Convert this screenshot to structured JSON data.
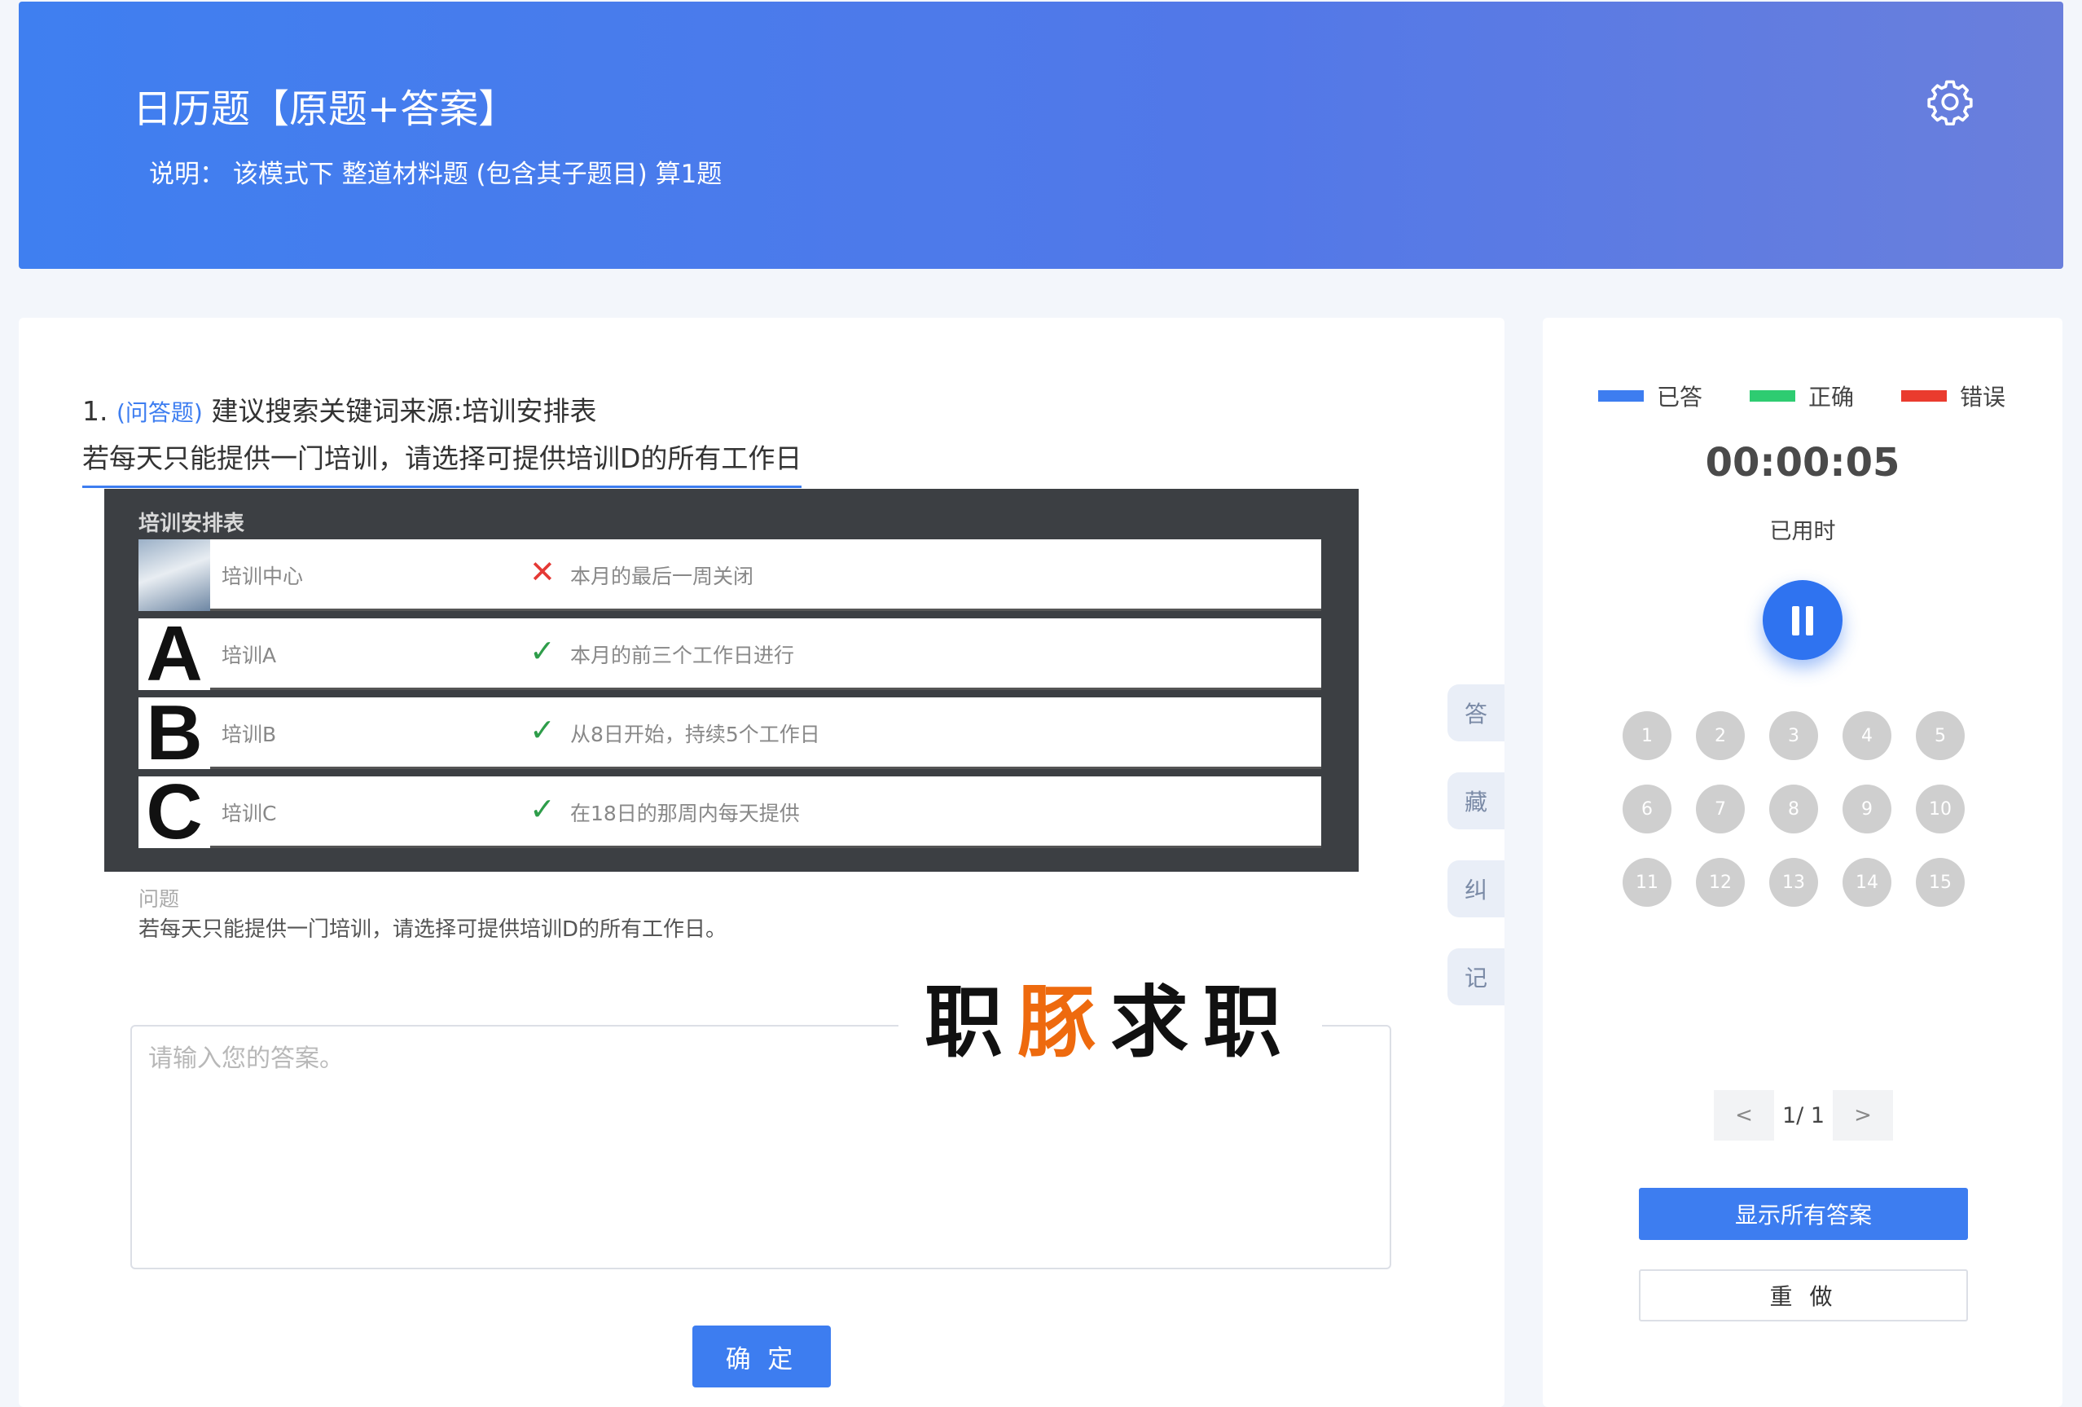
{
  "header": {
    "title": "日历题【原题+答案】",
    "description": "说明：  该模式下 整道材料题 (包含其子题目) 算1题",
    "settings_icon": "gear-icon"
  },
  "question": {
    "number": "1.",
    "type": "(问答题)",
    "source": "建议搜索关键词来源:培训安排表",
    "prompt": "若每天只能提供一门培训，请选择可提供培训D的所有工作日"
  },
  "side_tabs": [
    "答",
    "藏",
    "纠",
    "记"
  ],
  "reference_image": {
    "title": "培训安排表",
    "rows": [
      {
        "letter": "",
        "name": "培训中心",
        "mark": "✕",
        "mark_color": "#e53935",
        "desc": "本月的最后一周关闭"
      },
      {
        "letter": "A",
        "name": "培训A",
        "mark": "✓",
        "mark_color": "#2e9d4a",
        "desc": "本月的前三个工作日进行"
      },
      {
        "letter": "B",
        "name": "培训B",
        "mark": "✓",
        "mark_color": "#2e9d4a",
        "desc": "从8日开始，持续5个工作日"
      },
      {
        "letter": "C",
        "name": "培训C",
        "mark": "✓",
        "mark_color": "#2e9d4a",
        "desc": "在18日的那周内每天提供"
      }
    ],
    "question_label": "问题",
    "question_text": "若每天只能提供一门培训，请选择可提供培训D的所有工作日。"
  },
  "answer": {
    "placeholder": "请输入您的答案。",
    "value": ""
  },
  "watermark": {
    "part1": "职",
    "part2": "豚",
    "part3": "求职"
  },
  "confirm_label": "确 定",
  "legend": [
    {
      "label": "已答",
      "color": "#3d7df0"
    },
    {
      "label": "正确",
      "color": "#2ecc71"
    },
    {
      "label": "错误",
      "color": "#ea3b2e"
    }
  ],
  "timer": {
    "value": "00:00:05",
    "label": "已用时",
    "pause_icon": "pause-icon"
  },
  "question_numbers": [
    "1",
    "2",
    "3",
    "4",
    "5",
    "6",
    "7",
    "8",
    "9",
    "10",
    "11",
    "12",
    "13",
    "14",
    "15"
  ],
  "pager": {
    "prev": "<",
    "text": "1/ 1",
    "next": ">"
  },
  "buttons": {
    "show_all": "显示所有答案",
    "redo": "重 做"
  }
}
